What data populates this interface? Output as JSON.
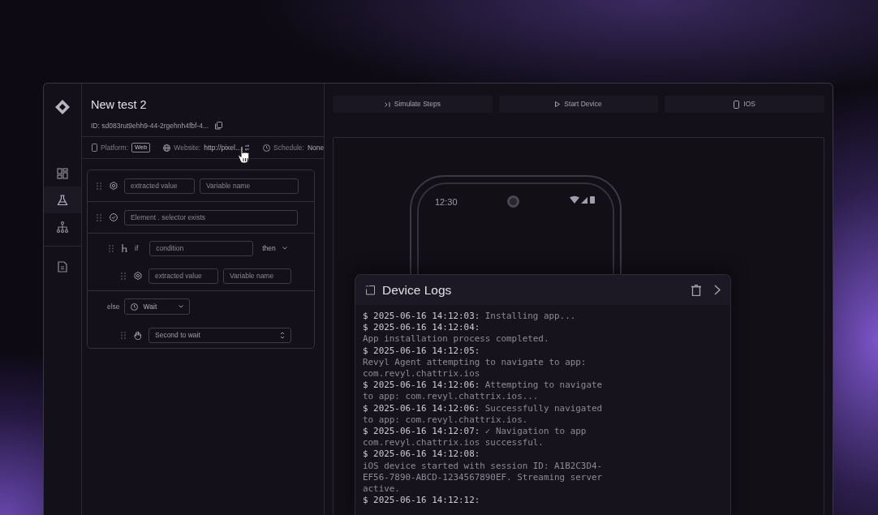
{
  "sidebar": {
    "items": [
      {
        "kind": "grid",
        "selected": false
      },
      {
        "kind": "flask",
        "selected": true
      },
      {
        "kind": "hierarchy",
        "selected": false
      },
      {
        "kind": "document",
        "selected": false
      }
    ]
  },
  "test": {
    "title": "New test 2",
    "id": "ID: sd083rut9ehh9-44-2rgehnh4fbf-4..."
  },
  "meta": {
    "platform_label": "Platform:",
    "platform": "Web",
    "website_label": "Website:",
    "website": "http://pixel...",
    "schedule_label": "Schedule:",
    "schedule": "None"
  },
  "steps": [
    {
      "kind": "extract",
      "value_placeholder": "extracted value",
      "name_placeholder": "Variable name"
    },
    {
      "kind": "assert",
      "placeholder": "Element . selector exists"
    },
    {
      "kind": "if",
      "label": "if",
      "placeholder": "condition",
      "then": "then",
      "children": [
        {
          "kind": "extract",
          "value_placeholder": "extracted value",
          "name_placeholder": "Variable name"
        }
      ]
    },
    {
      "kind": "else",
      "label": "else",
      "select": "Wait",
      "children": [
        {
          "kind": "wait",
          "placeholder": "Second to wait"
        }
      ]
    }
  ],
  "toolbar": [
    {
      "kind": "step",
      "label": "Simulate Steps"
    },
    {
      "kind": "play",
      "label": "Start Device"
    },
    {
      "kind": "phone",
      "label": "IOS"
    }
  ],
  "phone": {
    "time": "12:30"
  },
  "logs": {
    "title": "Device Logs",
    "lines": [
      {
        "time": "$ 2025-06-16 14:12:03:",
        "text": "Installing app..."
      },
      {
        "time": "$ 2025-06-16 14:12:04:"
      },
      {
        "text": "App installation process completed."
      },
      {
        "time": "$ 2025-06-16 14:12:05:"
      },
      {
        "text": "Revyl Agent attempting to navigate to app:"
      },
      {
        "text": "com.revyl.chattrix.ios"
      },
      {
        "time": "$ 2025-06-16 14:12:06:",
        "text": "Attempting to navigate"
      },
      {
        "text": "to app: com.revyl.chattrix.ios..."
      },
      {
        "time": "$ 2025-06-16 14:12:06:",
        "text": "Successfully navigated"
      },
      {
        "text": "to app: com.revyl.chattrix.ios."
      },
      {
        "time": "$ 2025-06-16 14:12:07:",
        "text": "✓ Navigation to app"
      },
      {
        "text": "com.revyl.chattrix.ios successful."
      },
      {
        "time": "$ 2025-06-16 14:12:08:"
      },
      {
        "text": "iOS device started with session ID: A1B2C3D4-"
      },
      {
        "text": "EF56-7890-ABCD-1234567890EF. Streaming server"
      },
      {
        "text": "active."
      },
      {
        "time": "$ 2025-06-16 14:12:12:"
      }
    ]
  }
}
